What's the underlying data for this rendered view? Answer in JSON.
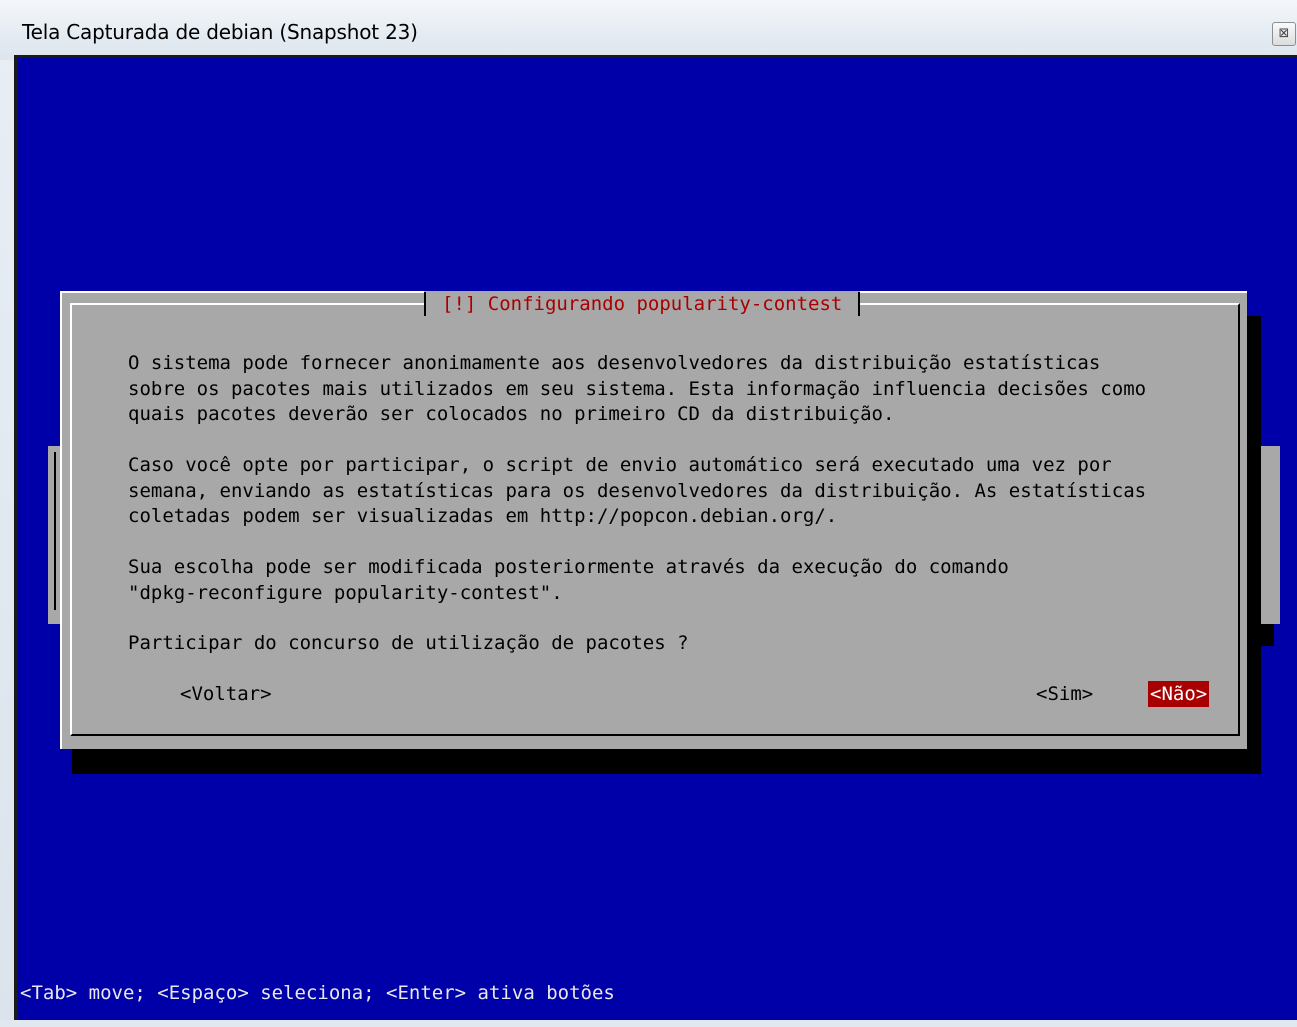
{
  "window": {
    "title": "Tela Capturada de debian (Snapshot 23)",
    "close_glyph": "⊠"
  },
  "dialog": {
    "title": "[!] Configurando popularity-contest",
    "paragraphs": [
      "O sistema pode fornecer anonimamente aos desenvolvedores da distribuição estatísticas\nsobre os pacotes mais utilizados em seu sistema. Esta informação influencia decisões como\nquais pacotes deverão ser colocados no primeiro CD da distribuição.",
      "Caso você opte por participar, o script de envio automático será executado uma vez por\nsemana, enviando as estatísticas para os desenvolvedores da distribuição. As estatísticas\ncoletadas podem ser visualizadas em http://popcon.debian.org/.",
      "Sua escolha pode ser modificada posteriormente através da execução do comando\n\"dpkg-reconfigure popularity-contest\".",
      "Participar do concurso de utilização de pacotes ?"
    ],
    "buttons": {
      "back": "<Voltar>",
      "yes": "<Sim>",
      "no": "<Não>"
    },
    "selected_button": "no",
    "colors": {
      "dialog_bg": "#a8a8a8",
      "title_fg": "#a80000",
      "selected_bg": "#a80000",
      "selected_fg": "#ffffff"
    }
  },
  "screen": {
    "background": "#0000a8",
    "hint": "<Tab> move; <Espaço> seleciona; <Enter> ativa botões"
  }
}
